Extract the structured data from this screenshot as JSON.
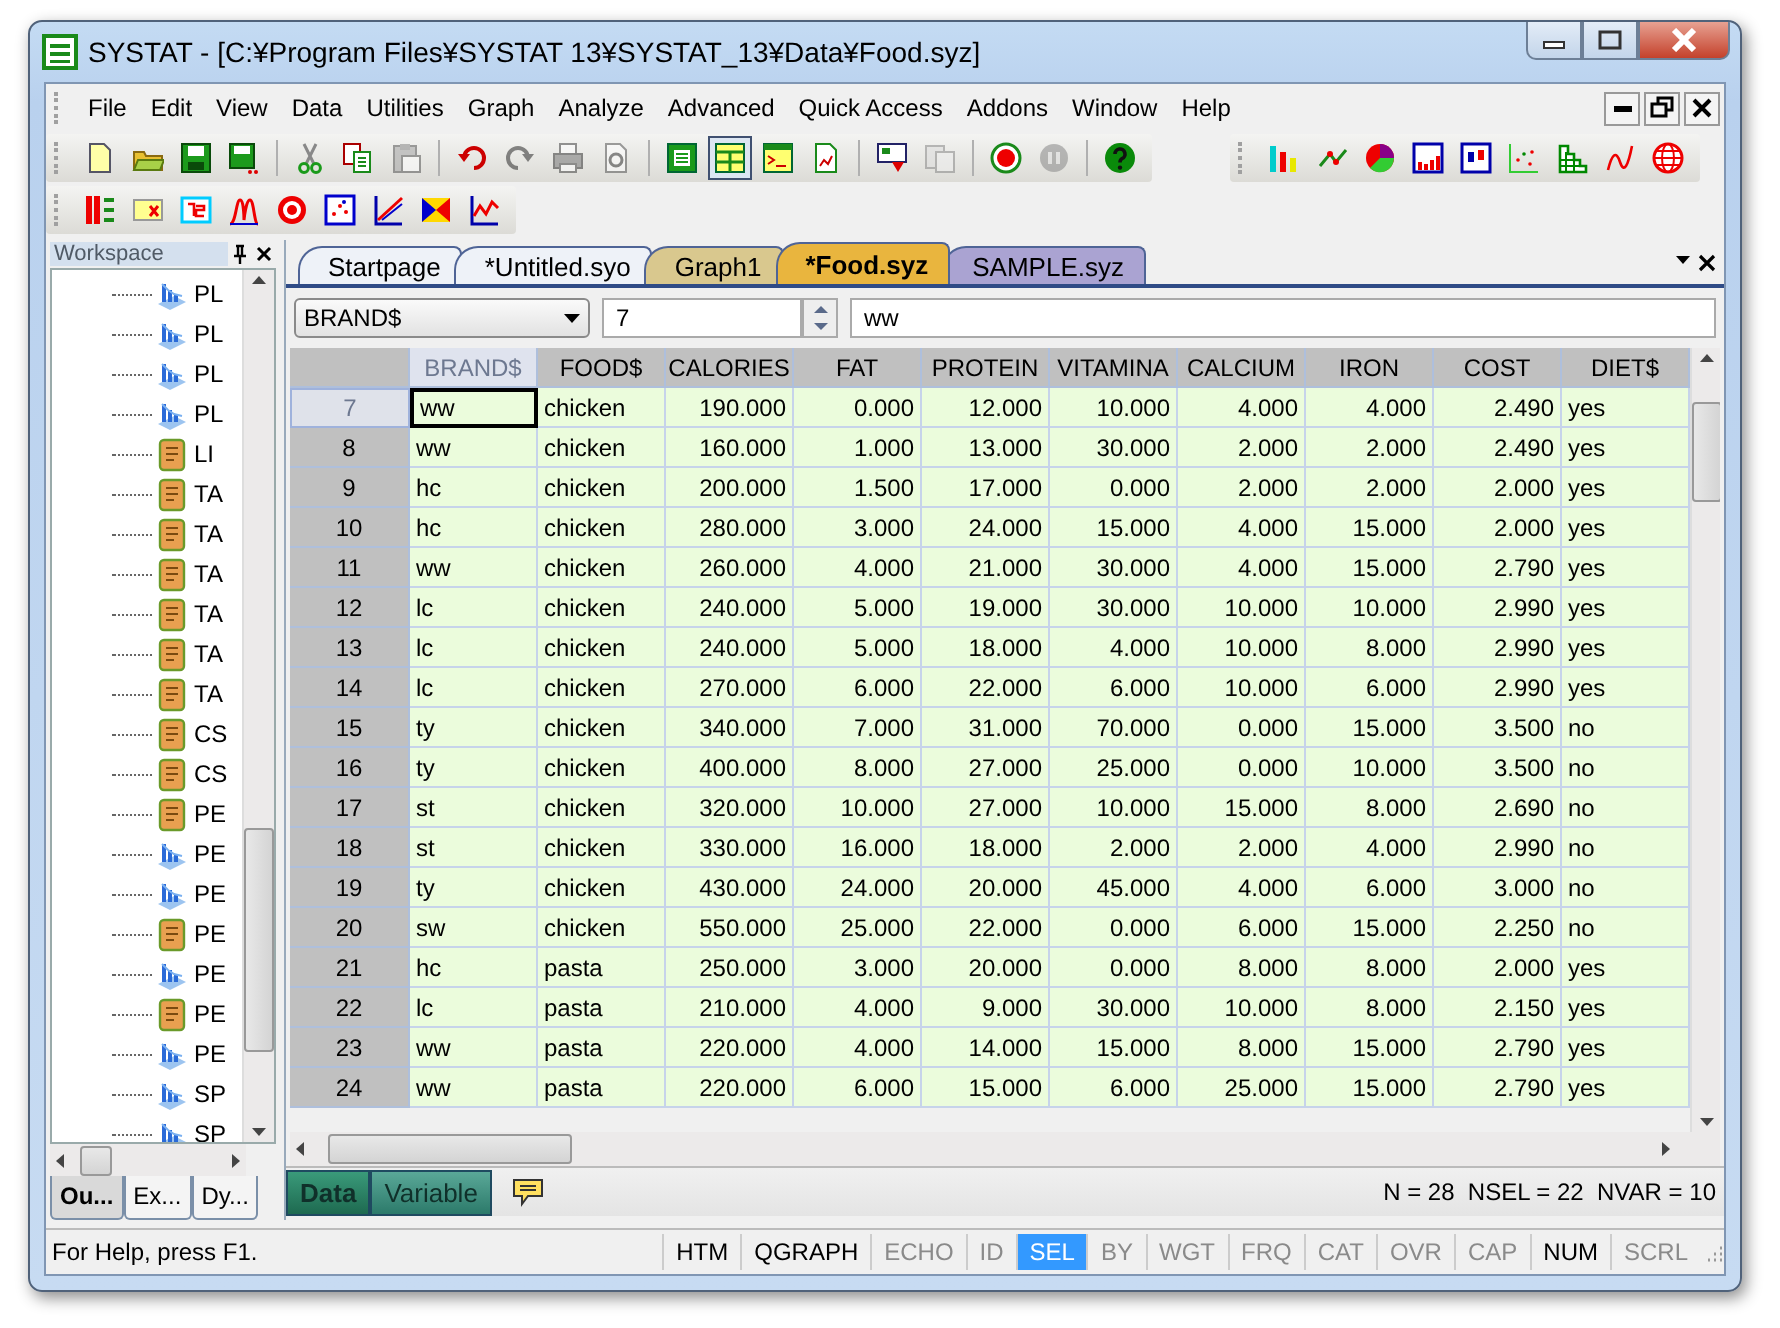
{
  "window": {
    "title": "SYSTAT - [C:¥Program Files¥SYSTAT 13¥SYSTAT_13¥Data¥Food.syz]"
  },
  "menu": [
    "File",
    "Edit",
    "View",
    "Data",
    "Utilities",
    "Graph",
    "Analyze",
    "Advanced",
    "Quick Access",
    "Addons",
    "Window",
    "Help"
  ],
  "main_toolbar": [
    {
      "disabled": false,
      "pressed": false
    },
    {
      "disabled": false,
      "pressed": false
    },
    {
      "disabled": false,
      "pressed": false
    },
    {
      "disabled": false,
      "pressed": false
    },
    {
      "disabled": false,
      "pressed": false
    },
    {
      "disabled": false,
      "pressed": false
    },
    {
      "disabled": true,
      "pressed": false
    },
    {
      "disabled": false,
      "pressed": false
    },
    {
      "disabled": true,
      "pressed": false
    },
    {
      "disabled": true,
      "pressed": false
    },
    {
      "disabled": true,
      "pressed": false
    },
    {
      "disabled": false,
      "pressed": false
    },
    {
      "disabled": false,
      "pressed": true
    },
    {
      "disabled": false,
      "pressed": false
    },
    {
      "disabled": false,
      "pressed": false
    },
    {
      "disabled": false,
      "pressed": false
    },
    {
      "disabled": true,
      "pressed": false
    },
    {
      "disabled": false,
      "pressed": false
    },
    {
      "disabled": true,
      "pressed": false
    },
    {
      "disabled": false,
      "pressed": false
    }
  ],
  "workspace": {
    "title": "Workspace",
    "items": [
      {
        "label": "PL",
        "kind": "chart"
      },
      {
        "label": "PL",
        "kind": "chart"
      },
      {
        "label": "PL",
        "kind": "chart"
      },
      {
        "label": "PL",
        "kind": "chart"
      },
      {
        "label": "LI",
        "kind": "doc"
      },
      {
        "label": "TA",
        "kind": "doc"
      },
      {
        "label": "TA",
        "kind": "doc"
      },
      {
        "label": "TA",
        "kind": "doc"
      },
      {
        "label": "TA",
        "kind": "doc"
      },
      {
        "label": "TA",
        "kind": "doc"
      },
      {
        "label": "TA",
        "kind": "doc"
      },
      {
        "label": "CS",
        "kind": "doc"
      },
      {
        "label": "CS",
        "kind": "doc"
      },
      {
        "label": "PE",
        "kind": "doc"
      },
      {
        "label": "PE",
        "kind": "chart"
      },
      {
        "label": "PE",
        "kind": "chart"
      },
      {
        "label": "PE",
        "kind": "doc"
      },
      {
        "label": "PE",
        "kind": "chart"
      },
      {
        "label": "PE",
        "kind": "doc"
      },
      {
        "label": "PE",
        "kind": "chart"
      },
      {
        "label": "SP",
        "kind": "chart"
      },
      {
        "label": "SP",
        "kind": "chart"
      }
    ],
    "tabs": [
      {
        "label": "Ou...",
        "selected": true
      },
      {
        "label": "Ex...",
        "selected": false
      },
      {
        "label": "Dy...",
        "selected": false
      }
    ]
  },
  "document_tabs": [
    {
      "label": "Startpage",
      "selected": false,
      "color": "#eef2f8"
    },
    {
      "label": "*Untitled.syo",
      "selected": false,
      "color": "#eef2f8"
    },
    {
      "label": "Graph1",
      "selected": false,
      "color": "#d9c88e"
    },
    {
      "label": "*Food.syz",
      "selected": true,
      "color": "#e9b53e"
    },
    {
      "label": "SAMPLE.syz",
      "selected": false,
      "color": "#aaa3d2"
    }
  ],
  "editor": {
    "variable": "BRAND$",
    "case": "7",
    "value": "ww",
    "columns": [
      {
        "name": "BRAND$",
        "kind": "text",
        "selected": true
      },
      {
        "name": "FOOD$",
        "kind": "text",
        "selected": false
      },
      {
        "name": "CALORIES",
        "kind": "number",
        "selected": false
      },
      {
        "name": "FAT",
        "kind": "number",
        "selected": false
      },
      {
        "name": "PROTEIN",
        "kind": "number",
        "selected": false
      },
      {
        "name": "VITAMINA",
        "kind": "number",
        "selected": false
      },
      {
        "name": "CALCIUM",
        "kind": "number",
        "selected": false
      },
      {
        "name": "IRON",
        "kind": "number",
        "selected": false
      },
      {
        "name": "COST",
        "kind": "number",
        "selected": false
      },
      {
        "name": "DIET$",
        "kind": "text",
        "selected": false
      }
    ],
    "rows": [
      {
        "case": "7",
        "selected": true,
        "cells": [
          "ww",
          "chicken",
          "190.000",
          "0.000",
          "12.000",
          "10.000",
          "4.000",
          "4.000",
          "2.490",
          "yes"
        ]
      },
      {
        "case": "8",
        "selected": false,
        "cells": [
          "ww",
          "chicken",
          "160.000",
          "1.000",
          "13.000",
          "30.000",
          "2.000",
          "2.000",
          "2.490",
          "yes"
        ]
      },
      {
        "case": "9",
        "selected": false,
        "cells": [
          "hc",
          "chicken",
          "200.000",
          "1.500",
          "17.000",
          "0.000",
          "2.000",
          "2.000",
          "2.000",
          "yes"
        ]
      },
      {
        "case": "10",
        "selected": false,
        "cells": [
          "hc",
          "chicken",
          "280.000",
          "3.000",
          "24.000",
          "15.000",
          "4.000",
          "15.000",
          "2.000",
          "yes"
        ]
      },
      {
        "case": "11",
        "selected": false,
        "cells": [
          "ww",
          "chicken",
          "260.000",
          "4.000",
          "21.000",
          "30.000",
          "4.000",
          "15.000",
          "2.790",
          "yes"
        ]
      },
      {
        "case": "12",
        "selected": false,
        "cells": [
          "lc",
          "chicken",
          "240.000",
          "5.000",
          "19.000",
          "30.000",
          "10.000",
          "10.000",
          "2.990",
          "yes"
        ]
      },
      {
        "case": "13",
        "selected": false,
        "cells": [
          "lc",
          "chicken",
          "240.000",
          "5.000",
          "18.000",
          "4.000",
          "10.000",
          "8.000",
          "2.990",
          "yes"
        ]
      },
      {
        "case": "14",
        "selected": false,
        "cells": [
          "lc",
          "chicken",
          "270.000",
          "6.000",
          "22.000",
          "6.000",
          "10.000",
          "6.000",
          "2.990",
          "yes"
        ]
      },
      {
        "case": "15",
        "selected": false,
        "cells": [
          "ty",
          "chicken",
          "340.000",
          "7.000",
          "31.000",
          "70.000",
          "0.000",
          "15.000",
          "3.500",
          "no"
        ]
      },
      {
        "case": "16",
        "selected": false,
        "cells": [
          "ty",
          "chicken",
          "400.000",
          "8.000",
          "27.000",
          "25.000",
          "0.000",
          "10.000",
          "3.500",
          "no"
        ]
      },
      {
        "case": "17",
        "selected": false,
        "cells": [
          "st",
          "chicken",
          "320.000",
          "10.000",
          "27.000",
          "10.000",
          "15.000",
          "8.000",
          "2.690",
          "no"
        ]
      },
      {
        "case": "18",
        "selected": false,
        "cells": [
          "st",
          "chicken",
          "330.000",
          "16.000",
          "18.000",
          "2.000",
          "2.000",
          "4.000",
          "2.990",
          "no"
        ]
      },
      {
        "case": "19",
        "selected": false,
        "cells": [
          "ty",
          "chicken",
          "430.000",
          "24.000",
          "20.000",
          "45.000",
          "4.000",
          "6.000",
          "3.000",
          "no"
        ]
      },
      {
        "case": "20",
        "selected": false,
        "cells": [
          "sw",
          "chicken",
          "550.000",
          "25.000",
          "22.000",
          "0.000",
          "6.000",
          "15.000",
          "2.250",
          "no"
        ]
      },
      {
        "case": "21",
        "selected": false,
        "cells": [
          "hc",
          "pasta",
          "250.000",
          "3.000",
          "20.000",
          "0.000",
          "8.000",
          "8.000",
          "2.000",
          "yes"
        ]
      },
      {
        "case": "22",
        "selected": false,
        "cells": [
          "lc",
          "pasta",
          "210.000",
          "4.000",
          "9.000",
          "30.000",
          "10.000",
          "8.000",
          "2.150",
          "yes"
        ]
      },
      {
        "case": "23",
        "selected": false,
        "cells": [
          "ww",
          "pasta",
          "220.000",
          "4.000",
          "14.000",
          "15.000",
          "8.000",
          "15.000",
          "2.790",
          "yes"
        ]
      },
      {
        "case": "24",
        "selected": false,
        "cells": [
          "ww",
          "pasta",
          "220.000",
          "6.000",
          "15.000",
          "6.000",
          "25.000",
          "15.000",
          "2.790",
          "yes"
        ]
      }
    ],
    "view_tabs": [
      {
        "label": "Data",
        "selected": true
      },
      {
        "label": "Variable",
        "selected": false
      }
    ],
    "counts": "N = 28  NSEL = 22  NVAR = 10"
  },
  "status_bar": {
    "message": "For Help, press F1.",
    "indicators": [
      {
        "label": "HTM",
        "on": true,
        "selected": false
      },
      {
        "label": "QGRAPH",
        "on": true,
        "selected": false
      },
      {
        "label": "ECHO",
        "on": false,
        "selected": false
      },
      {
        "label": "ID",
        "on": false,
        "selected": false
      },
      {
        "label": "SEL",
        "on": true,
        "selected": true
      },
      {
        "label": "BY",
        "on": false,
        "selected": false
      },
      {
        "label": "WGT",
        "on": false,
        "selected": false
      },
      {
        "label": "FRQ",
        "on": false,
        "selected": false
      },
      {
        "label": "CAT",
        "on": false,
        "selected": false
      },
      {
        "label": "OVR",
        "on": false,
        "selected": false
      },
      {
        "label": "CAP",
        "on": false,
        "selected": false
      },
      {
        "label": "NUM",
        "on": true,
        "selected": false
      },
      {
        "label": "SCRL",
        "on": false,
        "selected": false
      }
    ]
  }
}
